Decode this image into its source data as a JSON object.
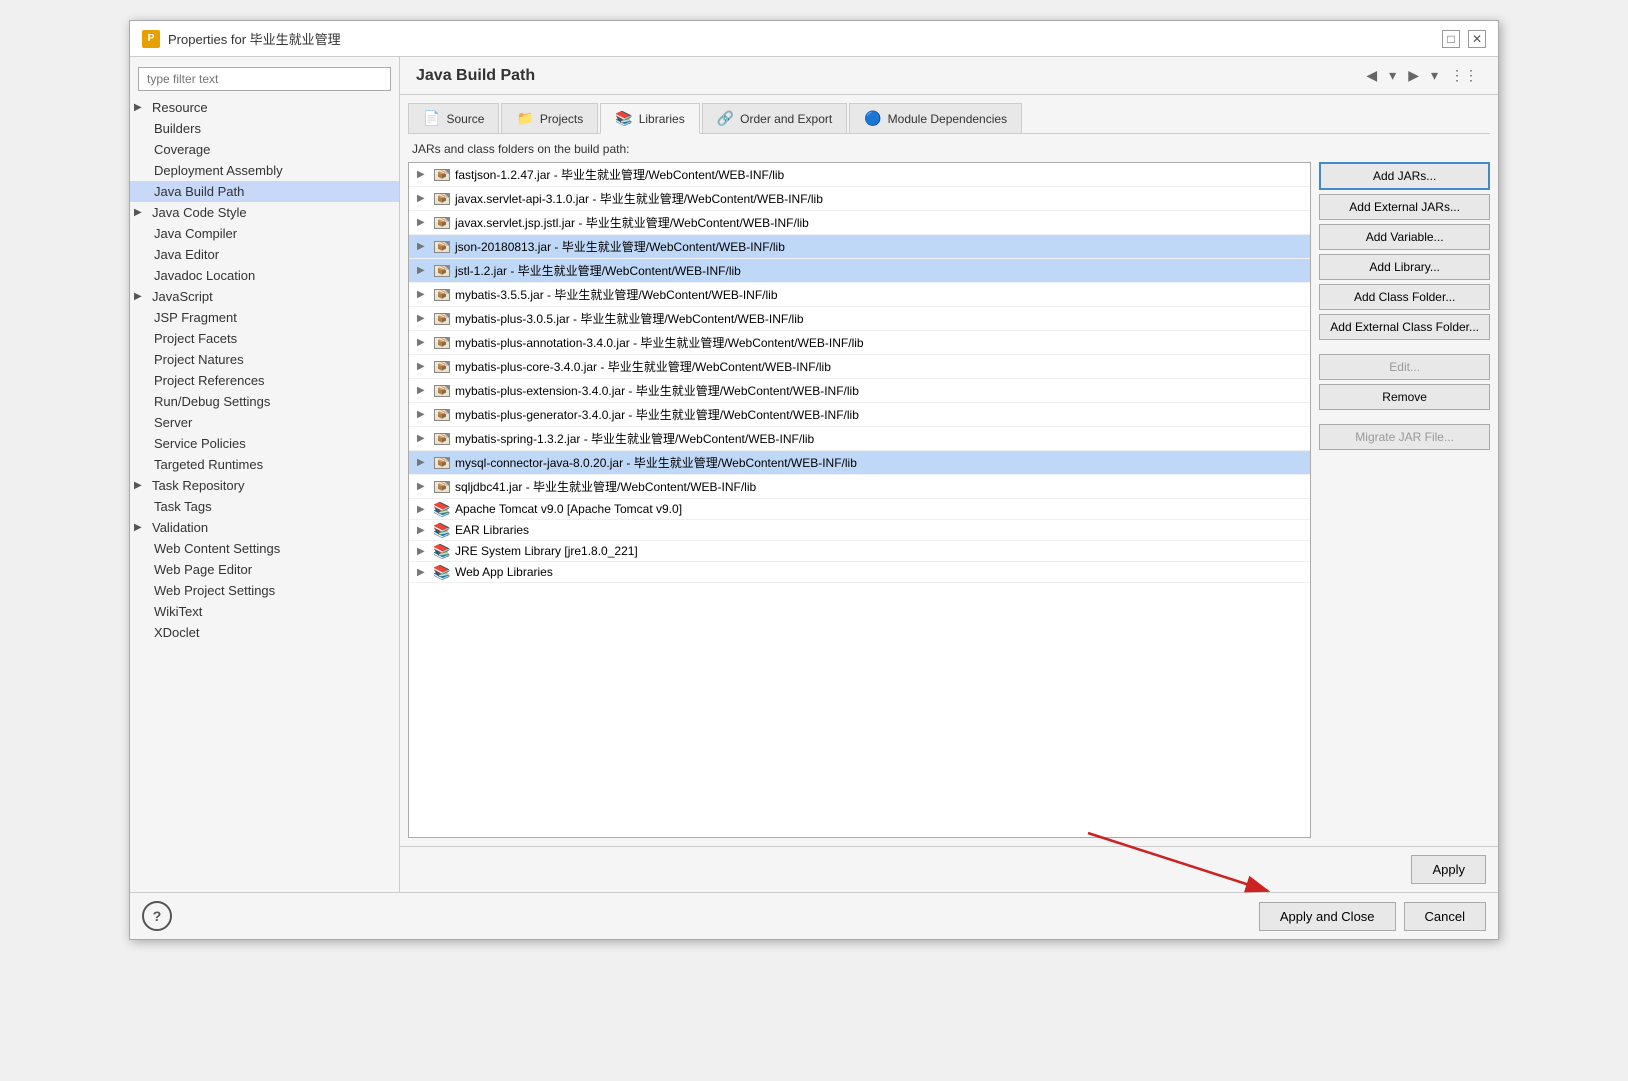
{
  "window": {
    "title": "Properties for 毕业生就业管理",
    "icon": "P"
  },
  "titlebar": {
    "maximize_label": "□",
    "close_label": "✕"
  },
  "sidebar": {
    "search_placeholder": "type filter text",
    "items": [
      {
        "id": "resource",
        "label": "Resource",
        "expandable": true,
        "indent": 0
      },
      {
        "id": "builders",
        "label": "Builders",
        "expandable": false,
        "indent": 1
      },
      {
        "id": "coverage",
        "label": "Coverage",
        "expandable": false,
        "indent": 1
      },
      {
        "id": "deployment-assembly",
        "label": "Deployment Assembly",
        "expandable": false,
        "indent": 1
      },
      {
        "id": "java-build-path",
        "label": "Java Build Path",
        "expandable": false,
        "indent": 1,
        "active": true
      },
      {
        "id": "java-code-style",
        "label": "Java Code Style",
        "expandable": true,
        "indent": 1
      },
      {
        "id": "java-compiler",
        "label": "Java Compiler",
        "expandable": false,
        "indent": 1
      },
      {
        "id": "java-editor",
        "label": "Java Editor",
        "expandable": false,
        "indent": 1
      },
      {
        "id": "javadoc-location",
        "label": "Javadoc Location",
        "expandable": false,
        "indent": 1
      },
      {
        "id": "javascript",
        "label": "JavaScript",
        "expandable": true,
        "indent": 1
      },
      {
        "id": "jsp-fragment",
        "label": "JSP Fragment",
        "expandable": false,
        "indent": 1
      },
      {
        "id": "project-facets",
        "label": "Project Facets",
        "expandable": false,
        "indent": 1
      },
      {
        "id": "project-natures",
        "label": "Project Natures",
        "expandable": false,
        "indent": 1
      },
      {
        "id": "project-references",
        "label": "Project References",
        "expandable": false,
        "indent": 1
      },
      {
        "id": "run-debug-settings",
        "label": "Run/Debug Settings",
        "expandable": false,
        "indent": 1
      },
      {
        "id": "server",
        "label": "Server",
        "expandable": false,
        "indent": 1
      },
      {
        "id": "service-policies",
        "label": "Service Policies",
        "expandable": false,
        "indent": 1
      },
      {
        "id": "targeted-runtimes",
        "label": "Targeted Runtimes",
        "expandable": false,
        "indent": 1
      },
      {
        "id": "task-repository",
        "label": "Task Repository",
        "expandable": true,
        "indent": 1
      },
      {
        "id": "task-tags",
        "label": "Task Tags",
        "expandable": false,
        "indent": 1
      },
      {
        "id": "validation",
        "label": "Validation",
        "expandable": true,
        "indent": 1
      },
      {
        "id": "web-content-settings",
        "label": "Web Content Settings",
        "expandable": false,
        "indent": 1
      },
      {
        "id": "web-page-editor",
        "label": "Web Page Editor",
        "expandable": false,
        "indent": 1
      },
      {
        "id": "web-project-settings",
        "label": "Web Project Settings",
        "expandable": false,
        "indent": 1
      },
      {
        "id": "wikitext",
        "label": "WikiText",
        "expandable": false,
        "indent": 1
      },
      {
        "id": "xdoclet",
        "label": "XDoclet",
        "expandable": false,
        "indent": 1
      }
    ]
  },
  "main": {
    "title": "Java Build Path",
    "description": "JARs and class folders on the build path:",
    "tabs": [
      {
        "id": "source",
        "label": "Source",
        "icon": "📄"
      },
      {
        "id": "projects",
        "label": "Projects",
        "icon": "📁"
      },
      {
        "id": "libraries",
        "label": "Libraries",
        "icon": "📚",
        "active": true
      },
      {
        "id": "order-export",
        "label": "Order and Export",
        "icon": "🔗"
      },
      {
        "id": "module-dependencies",
        "label": "Module Dependencies",
        "icon": "🔵"
      }
    ],
    "jar_items": [
      {
        "name": "fastjson-1.2.47.jar - 毕业生就业管理/WebContent/WEB-INF/lib",
        "type": "jar",
        "highlighted": false
      },
      {
        "name": "javax.servlet-api-3.1.0.jar - 毕业生就业管理/WebContent/WEB-INF/lib",
        "type": "jar",
        "highlighted": false
      },
      {
        "name": "javax.servlet.jsp.jstl.jar - 毕业生就业管理/WebContent/WEB-INF/lib",
        "type": "jar",
        "highlighted": false
      },
      {
        "name": "json-20180813.jar - 毕业生就业管理/WebContent/WEB-INF/lib",
        "type": "jar",
        "highlighted": true
      },
      {
        "name": "jstl-1.2.jar - 毕业生就业管理/WebContent/WEB-INF/lib",
        "type": "jar",
        "highlighted": true
      },
      {
        "name": "mybatis-3.5.5.jar - 毕业生就业管理/WebContent/WEB-INF/lib",
        "type": "jar",
        "highlighted": false
      },
      {
        "name": "mybatis-plus-3.0.5.jar - 毕业生就业管理/WebContent/WEB-INF/lib",
        "type": "jar",
        "highlighted": false
      },
      {
        "name": "mybatis-plus-annotation-3.4.0.jar - 毕业生就业管理/WebContent/WEB-INF/lib",
        "type": "jar",
        "highlighted": false
      },
      {
        "name": "mybatis-plus-core-3.4.0.jar - 毕业生就业管理/WebContent/WEB-INF/lib",
        "type": "jar",
        "highlighted": false
      },
      {
        "name": "mybatis-plus-extension-3.4.0.jar - 毕业生就业管理/WebContent/WEB-INF/lib",
        "type": "jar",
        "highlighted": false
      },
      {
        "name": "mybatis-plus-generator-3.4.0.jar - 毕业生就业管理/WebContent/WEB-INF/lib",
        "type": "jar",
        "highlighted": false
      },
      {
        "name": "mybatis-spring-1.3.2.jar - 毕业生就业管理/WebContent/WEB-INF/lib",
        "type": "jar",
        "highlighted": false
      },
      {
        "name": "mysql-connector-java-8.0.20.jar - 毕业生就业管理/WebContent/WEB-INF/lib",
        "type": "jar",
        "highlighted": true
      },
      {
        "name": "sqljdbc41.jar - 毕业生就业管理/WebContent/WEB-INF/lib",
        "type": "jar",
        "highlighted": false
      },
      {
        "name": "Apache Tomcat v9.0 [Apache Tomcat v9.0]",
        "type": "lib",
        "highlighted": false
      },
      {
        "name": "EAR Libraries",
        "type": "lib",
        "highlighted": false
      },
      {
        "name": "JRE System Library [jre1.8.0_221]",
        "type": "lib",
        "highlighted": false
      },
      {
        "name": "Web App Libraries",
        "type": "lib",
        "highlighted": false
      }
    ],
    "buttons": {
      "add_jars": "Add JARs...",
      "add_external_jars": "Add External JARs...",
      "add_variable": "Add Variable...",
      "add_library": "Add Library...",
      "add_class_folder": "Add Class Folder...",
      "add_external_class_folder": "Add External Class Folder...",
      "edit": "Edit...",
      "remove": "Remove",
      "migrate_jar_file": "Migrate JAR File..."
    }
  },
  "bottom": {
    "apply_label": "Apply",
    "apply_close_label": "Apply and Close",
    "cancel_label": "Cancel",
    "help_label": "?"
  },
  "colors": {
    "accent": "#4488cc",
    "highlight_blue": "#bcd4f7",
    "highlight_darker": "#c0d8f8",
    "active_sidebar": "#c8d8f8"
  }
}
